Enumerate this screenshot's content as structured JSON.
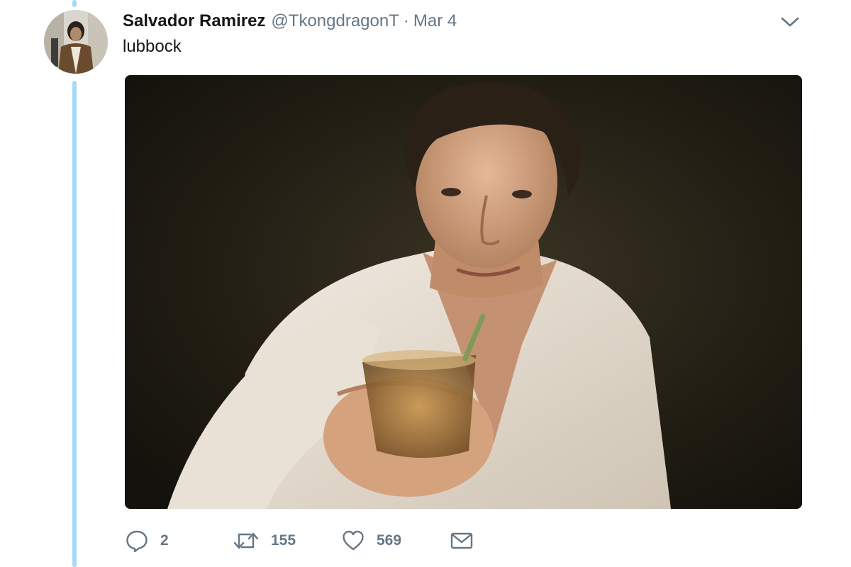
{
  "tweet": {
    "display_name": "Salvador Ramirez",
    "handle": "@TkongdragonT",
    "separator": "·",
    "timestamp": "Mar 4",
    "text": "lubbock",
    "media": {
      "kind": "photo",
      "subject": "man in white shirt raising a glass toward the viewer"
    }
  },
  "actions": {
    "reply_count": "2",
    "retweet_count": "155",
    "like_count": "569"
  },
  "icons": {
    "reply": "reply-icon",
    "retweet": "retweet-icon",
    "like": "heart-icon",
    "dm": "envelope-icon",
    "more": "chevron-down-icon"
  },
  "colors": {
    "thread_line": "#a4d9f9",
    "secondary_text": "#657786",
    "primary_text": "#14171a"
  }
}
